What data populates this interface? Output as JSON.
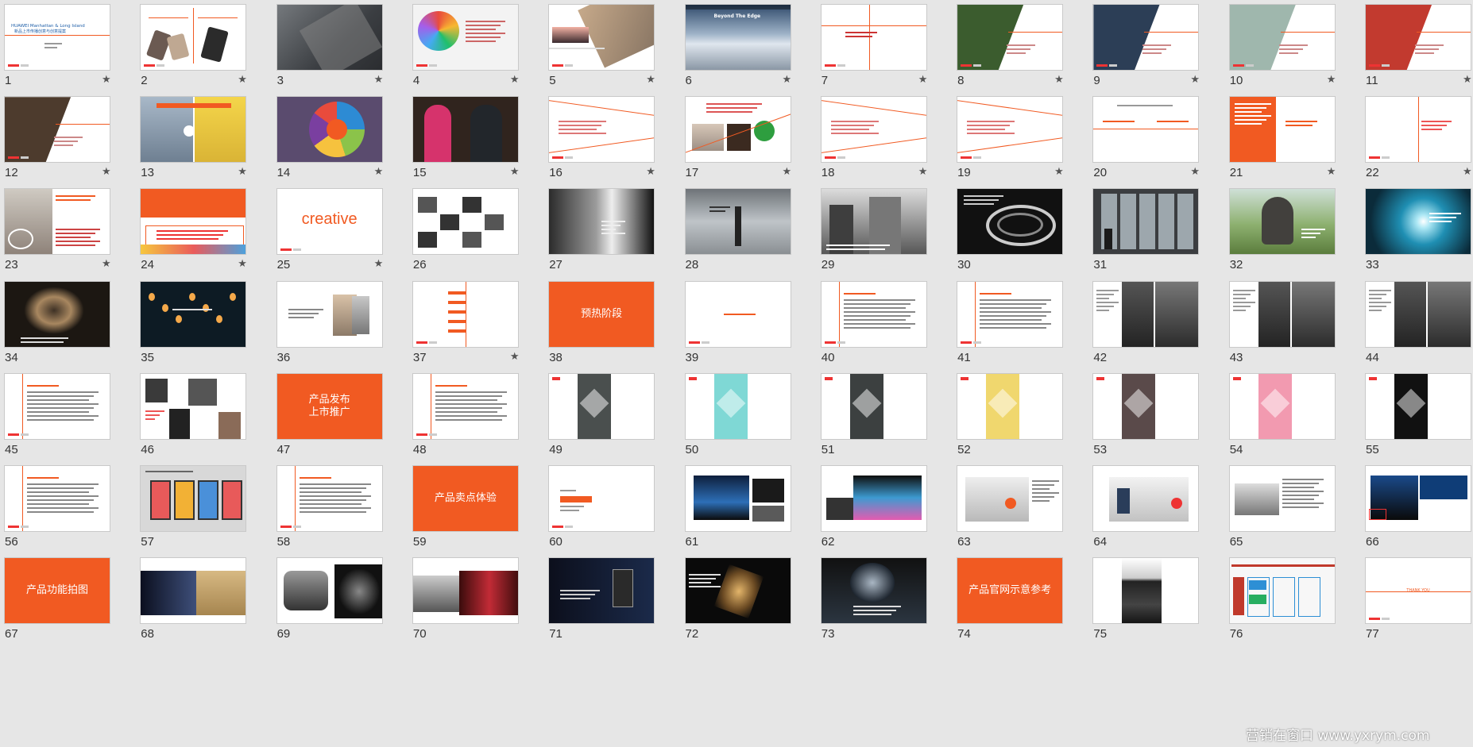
{
  "slides": [
    {
      "num": "1",
      "star": true,
      "style": "title",
      "title": "HUAWEI Manhattan & Long Island",
      "subtitle": "新品上市传播创意与创意提案"
    },
    {
      "num": "2",
      "star": true,
      "style": "split-phones"
    },
    {
      "num": "3",
      "star": true,
      "style": "photo-dark",
      "bg": "#4a4d52"
    },
    {
      "num": "4",
      "star": true,
      "style": "brain"
    },
    {
      "num": "5",
      "star": true,
      "style": "phone-diag"
    },
    {
      "num": "6",
      "star": true,
      "style": "mountain",
      "caption": "Beyond The Edge"
    },
    {
      "num": "7",
      "star": true,
      "style": "lines"
    },
    {
      "num": "8",
      "star": true,
      "style": "diag-photo",
      "bg": "#3b5c2e"
    },
    {
      "num": "9",
      "star": true,
      "style": "diag-photo",
      "bg": "#2c3e56"
    },
    {
      "num": "10",
      "star": true,
      "style": "diag-photo",
      "bg": "#9fb7ad"
    },
    {
      "num": "11",
      "star": true,
      "style": "diag-photo",
      "bg": "#c23a2f"
    },
    {
      "num": "12",
      "star": true,
      "style": "diag-photo",
      "bg": "#4d3b2d"
    },
    {
      "num": "13",
      "star": true,
      "style": "bulbs"
    },
    {
      "num": "14",
      "star": true,
      "style": "pie"
    },
    {
      "num": "15",
      "star": true,
      "style": "people"
    },
    {
      "num": "16",
      "star": true,
      "style": "lines-text"
    },
    {
      "num": "17",
      "star": true,
      "style": "collage-red"
    },
    {
      "num": "18",
      "star": true,
      "style": "lines-text"
    },
    {
      "num": "19",
      "star": true,
      "style": "lines-text"
    },
    {
      "num": "20",
      "star": true,
      "style": "twocol"
    },
    {
      "num": "21",
      "star": true,
      "style": "orange-left"
    },
    {
      "num": "22",
      "star": true,
      "style": "vline-center"
    },
    {
      "num": "23",
      "star": true,
      "style": "airbnb"
    },
    {
      "num": "24",
      "star": true,
      "style": "orange-top"
    },
    {
      "num": "25",
      "star": true,
      "style": "creative",
      "word": "creative"
    },
    {
      "num": "26",
      "star": false,
      "style": "grid-bw"
    },
    {
      "num": "27",
      "star": false,
      "style": "bw-portrait"
    },
    {
      "num": "28",
      "star": false,
      "style": "lighthouse"
    },
    {
      "num": "29",
      "star": false,
      "style": "buildings"
    },
    {
      "num": "30",
      "star": false,
      "style": "spiral"
    },
    {
      "num": "31",
      "star": false,
      "style": "window"
    },
    {
      "num": "32",
      "star": false,
      "style": "cyclist"
    },
    {
      "num": "33",
      "star": false,
      "style": "tunnel"
    },
    {
      "num": "34",
      "star": false,
      "style": "lens"
    },
    {
      "num": "35",
      "star": false,
      "style": "lights"
    },
    {
      "num": "36",
      "star": false,
      "style": "phone-white"
    },
    {
      "num": "37",
      "star": true,
      "style": "list-red"
    },
    {
      "num": "38",
      "star": false,
      "style": "orange",
      "label": "预热阶段"
    },
    {
      "num": "39",
      "star": false,
      "style": "blank-text"
    },
    {
      "num": "40",
      "star": false,
      "style": "vline-text"
    },
    {
      "num": "41",
      "star": false,
      "style": "vline-text"
    },
    {
      "num": "42",
      "star": false,
      "style": "two-faces"
    },
    {
      "num": "43",
      "star": false,
      "style": "two-faces"
    },
    {
      "num": "44",
      "star": false,
      "style": "two-faces"
    },
    {
      "num": "45",
      "star": false,
      "style": "vline-text"
    },
    {
      "num": "46",
      "star": false,
      "style": "portraits"
    },
    {
      "num": "47",
      "star": false,
      "style": "orange",
      "label": "产品发布\n上市推广"
    },
    {
      "num": "48",
      "star": false,
      "style": "vline-text"
    },
    {
      "num": "49",
      "star": false,
      "style": "poster",
      "bg": "#4a4f4e"
    },
    {
      "num": "50",
      "star": false,
      "style": "poster",
      "bg": "#7fd8d5"
    },
    {
      "num": "51",
      "star": false,
      "style": "poster",
      "bg": "#3c4040"
    },
    {
      "num": "52",
      "star": false,
      "style": "poster",
      "bg": "#f0d76e"
    },
    {
      "num": "53",
      "star": false,
      "style": "poster",
      "bg": "#5a4a4a"
    },
    {
      "num": "54",
      "star": false,
      "style": "poster",
      "bg": "#f29ab0"
    },
    {
      "num": "55",
      "star": false,
      "style": "poster",
      "bg": "#111111"
    },
    {
      "num": "56",
      "star": false,
      "style": "vline-text"
    },
    {
      "num": "57",
      "star": false,
      "style": "phones-row"
    },
    {
      "num": "58",
      "star": false,
      "style": "vline-text"
    },
    {
      "num": "59",
      "star": false,
      "style": "orange",
      "label": "产品卖点体验"
    },
    {
      "num": "60",
      "star": false,
      "style": "slogan"
    },
    {
      "num": "61",
      "star": false,
      "style": "stage"
    },
    {
      "num": "62",
      "star": false,
      "style": "stage2"
    },
    {
      "num": "63",
      "star": false,
      "style": "booth"
    },
    {
      "num": "64",
      "star": false,
      "style": "booth2"
    },
    {
      "num": "65",
      "star": false,
      "style": "booth3"
    },
    {
      "num": "66",
      "star": false,
      "style": "event"
    },
    {
      "num": "67",
      "star": false,
      "style": "orange",
      "label": "产品功能拍图"
    },
    {
      "num": "68",
      "star": false,
      "style": "dna"
    },
    {
      "num": "69",
      "star": false,
      "style": "camera"
    },
    {
      "num": "70",
      "star": false,
      "style": "red-wave"
    },
    {
      "num": "71",
      "star": false,
      "style": "dark-wave"
    },
    {
      "num": "72",
      "star": false,
      "style": "dark-gold"
    },
    {
      "num": "73",
      "star": false,
      "style": "dark-phone"
    },
    {
      "num": "74",
      "star": false,
      "style": "orange",
      "label": "产品官网示意参考"
    },
    {
      "num": "75",
      "star": false,
      "style": "website"
    },
    {
      "num": "76",
      "star": false,
      "style": "flow"
    },
    {
      "num": "77",
      "star": false,
      "style": "thanks",
      "label": "THANK YOU"
    }
  ],
  "watermark": "营销在窗口 www.yxrym.com",
  "colors": {
    "accent": "#f15a22",
    "background": "#e6e6e6"
  }
}
